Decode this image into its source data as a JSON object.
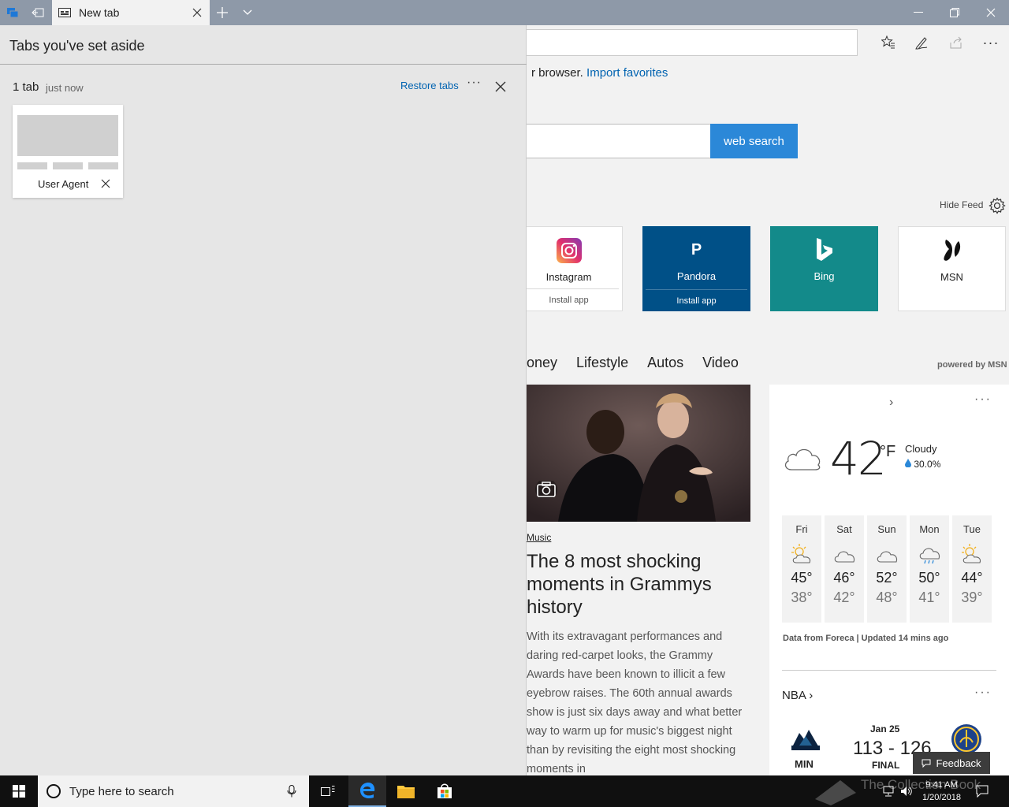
{
  "window": {
    "tab_title": "New tab",
    "colors": {
      "titlebar": "#8e99a8",
      "accent": "#2b88d8",
      "link": "#0063b1"
    }
  },
  "page": {
    "import_prefix": "r browser.",
    "import_link": "Import favorites",
    "search_button": "web search",
    "hide_feed": "Hide Feed",
    "tiles": [
      {
        "name": "Instagram",
        "sub": "Install app",
        "icon": "instagram-icon"
      },
      {
        "name": "Pandora",
        "sub": "Install app",
        "icon": "pandora-icon"
      },
      {
        "name": "Bing",
        "sub": "",
        "icon": "bing-icon"
      },
      {
        "name": "MSN",
        "sub": "",
        "icon": "msn-icon"
      }
    ],
    "categories": [
      "oney",
      "Lifestyle",
      "Autos",
      "Video"
    ],
    "powered_by": "powered by MSN",
    "article": {
      "category": "Music",
      "title": "The 8 most shocking moments in Grammys history",
      "body": "With its extravagant performances and daring red-carpet looks, the Grammy Awards have been known to illicit a few eyebrow raises. The 60th annual awards show is just six days away and what better way to warm up for music's biggest night than by revisiting the eight most shocking moments in"
    },
    "weather": {
      "temp": "42",
      "unit": "°F",
      "condition": "Cloudy",
      "precip": "30.0%",
      "forecast": [
        {
          "day": "Fri",
          "hi": "45°",
          "lo": "38°",
          "icon": "partly-sunny-icon"
        },
        {
          "day": "Sat",
          "hi": "46°",
          "lo": "42°",
          "icon": "cloudy-icon"
        },
        {
          "day": "Sun",
          "hi": "52°",
          "lo": "48°",
          "icon": "cloudy-icon"
        },
        {
          "day": "Mon",
          "hi": "50°",
          "lo": "41°",
          "icon": "rain-icon"
        },
        {
          "day": "Tue",
          "hi": "44°",
          "lo": "39°",
          "icon": "partly-sunny-icon"
        }
      ],
      "source": "Data from Foreca | Updated 14 mins ago"
    },
    "nba": {
      "title": "NBA",
      "date": "Jan 25",
      "score": "113 - 126",
      "status": "FINAL",
      "home": "MIN"
    },
    "feedback": "Feedback"
  },
  "aside_panel": {
    "title": "Tabs you've set aside",
    "group_count": "1 tab",
    "group_time": "just now",
    "restore": "Restore tabs",
    "more": "···",
    "tab_label": "User Agent"
  },
  "taskbar": {
    "search_placeholder": "Type here to search",
    "time": "9:41 AM",
    "date": "1/20/2018",
    "watermark": "The Collection Book"
  }
}
